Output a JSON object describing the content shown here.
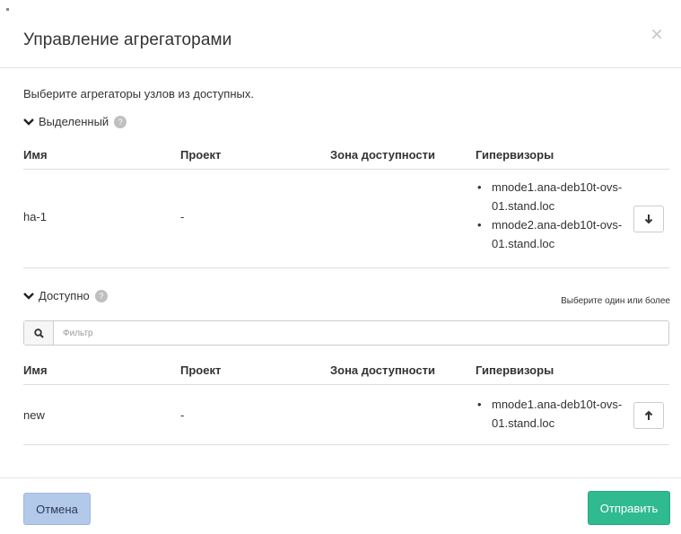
{
  "dialog": {
    "title": "Управление агрегаторами",
    "close_icon": "close-icon",
    "intro": "Выберите агрегаторы узлов из доступных."
  },
  "selected": {
    "label": "Выделенный",
    "columns": [
      "Имя",
      "Проект",
      "Зона доступности",
      "Гипервизоры"
    ],
    "rows": [
      {
        "name": "ha-1",
        "project": "-",
        "zone": "",
        "hypervisors": [
          "mnode1.ana-deb10t-ovs-01.stand.loc",
          "mnode2.ana-deb10t-ovs-01.stand.loc"
        ],
        "action_icon": "arrow-down-icon"
      }
    ]
  },
  "available": {
    "label": "Доступно",
    "hint": "Выберите один или более",
    "filter_placeholder": "Фильтр",
    "search_icon": "search-icon",
    "columns": [
      "Имя",
      "Проект",
      "Зона доступности",
      "Гипервизоры"
    ],
    "rows": [
      {
        "name": "new",
        "project": "-",
        "zone": "",
        "hypervisors": [
          "mnode1.ana-deb10t-ovs-01.stand.loc"
        ],
        "action_icon": "arrow-up-icon"
      }
    ]
  },
  "footer": {
    "cancel_label": "Отмена",
    "submit_label": "Отправить"
  },
  "colors": {
    "submit": "#2fba8f",
    "cancel": "#b3c9ea",
    "help_icon": "#bfbfbf"
  }
}
